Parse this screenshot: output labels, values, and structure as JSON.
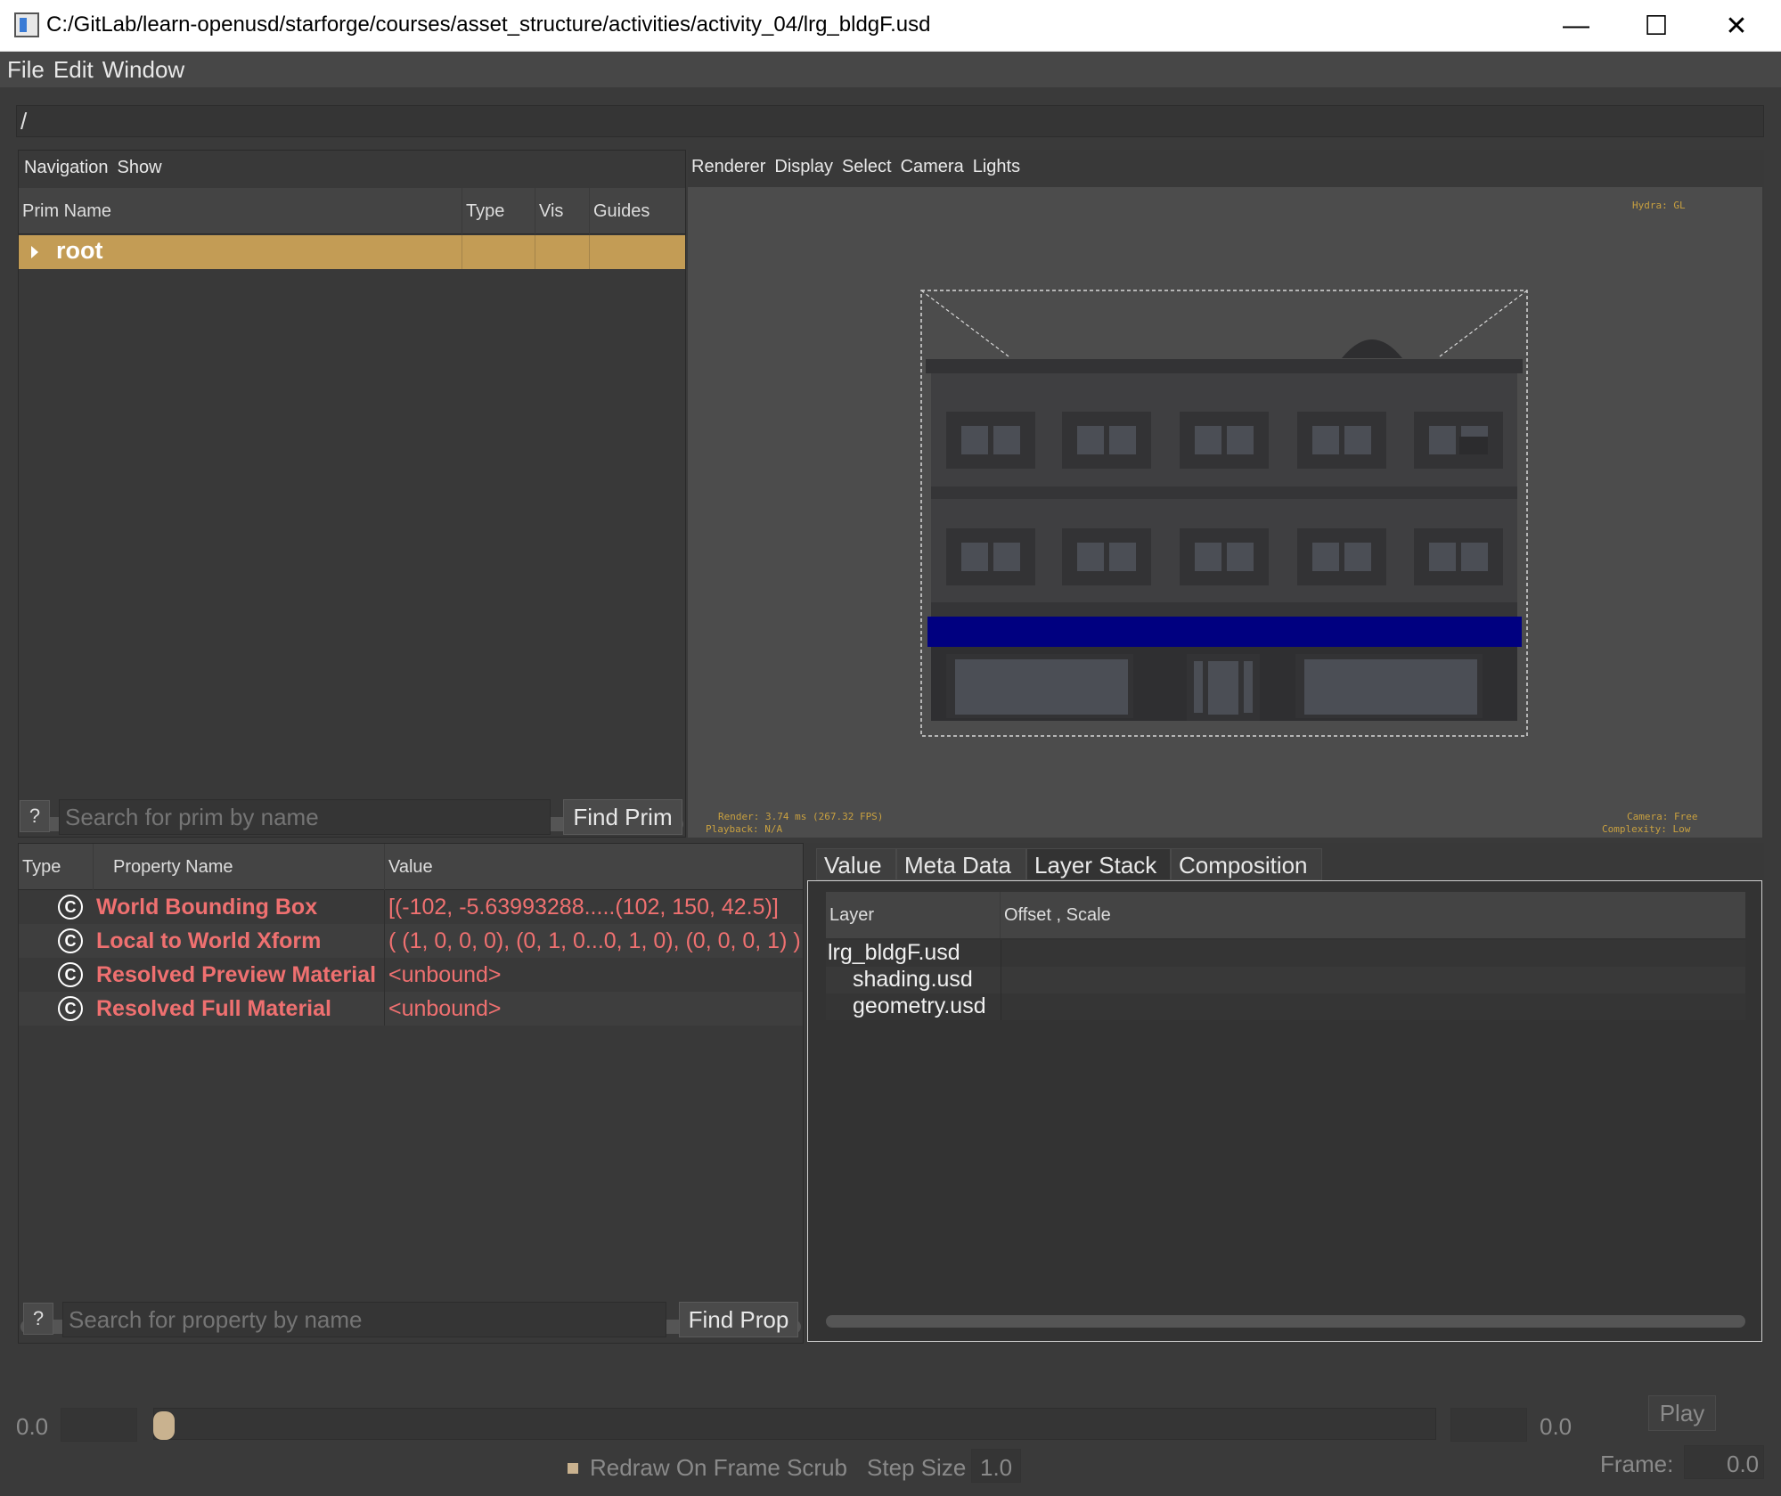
{
  "window": {
    "title": "C:/GitLab/learn-openusd/starforge/courses/asset_structure/activities/activity_04/lrg_bldgF.usd",
    "minimize": "—",
    "maximize": "☐",
    "close": "✕"
  },
  "menubar": {
    "file": "File",
    "edit": "Edit",
    "window": "Window"
  },
  "path": "/",
  "prim_browser": {
    "menu": {
      "navigation": "Navigation",
      "show": "Show"
    },
    "columns": {
      "name": "Prim Name",
      "type": "Type",
      "vis": "Vis",
      "guides": "Guides"
    },
    "rows": [
      {
        "name": "root"
      }
    ],
    "help": "?",
    "search_placeholder": "Search for prim by name",
    "find_button": "Find Prim"
  },
  "viewport": {
    "menu": {
      "renderer": "Renderer",
      "display": "Display",
      "select": "Select",
      "camera": "Camera",
      "lights": "Lights"
    },
    "hud": {
      "renderer": "Hydra: GL",
      "render": "Render: 3.74 ms (267.32 FPS)",
      "playback": "Playback: N/A",
      "camera": "Camera: Free",
      "complexity": "Complexity: Low"
    },
    "colors": {
      "background": "#4c4c4c",
      "awning": "#000080",
      "building": "#3d3d3f",
      "window_glass": "#4b4e55"
    }
  },
  "properties": {
    "columns": {
      "type": "Type",
      "name": "Property Name",
      "value": "Value"
    },
    "rows": [
      {
        "icon": "C",
        "name": "World Bounding Box",
        "value": "[(-102, -5.63993288.....(102, 150, 42.5)]"
      },
      {
        "icon": "C",
        "name": "Local to World Xform",
        "value": "( (1, 0, 0, 0), (0, 1, 0...0, 1, 0), (0, 0, 0, 1) )"
      },
      {
        "icon": "C",
        "name": "Resolved Preview Material",
        "value": "<unbound>"
      },
      {
        "icon": "C",
        "name": "Resolved Full Material",
        "value": "<unbound>"
      }
    ],
    "help": "?",
    "search_placeholder": "Search for property by name",
    "find_button": "Find Prop"
  },
  "layer_stack": {
    "tabs": {
      "value": "Value",
      "metadata": "Meta Data",
      "layer_stack": "Layer Stack",
      "composition": "Composition"
    },
    "columns": {
      "layer": "Layer",
      "offset": "Offset , Scale"
    },
    "layers": {
      "root": "lrg_bldgF.usd",
      "shading": "shading.usd",
      "geometry": "geometry.usd"
    }
  },
  "timeline": {
    "start": "0.0",
    "end": "0.0",
    "progress": 0,
    "play": "Play",
    "redraw": "Redraw On Frame Scrub",
    "step_size_label": "Step Size",
    "step_size": "1.0",
    "frame_label": "Frame:",
    "frame": "0.0"
  },
  "accent": "#c39c55",
  "error_text_color": "#ef7070"
}
